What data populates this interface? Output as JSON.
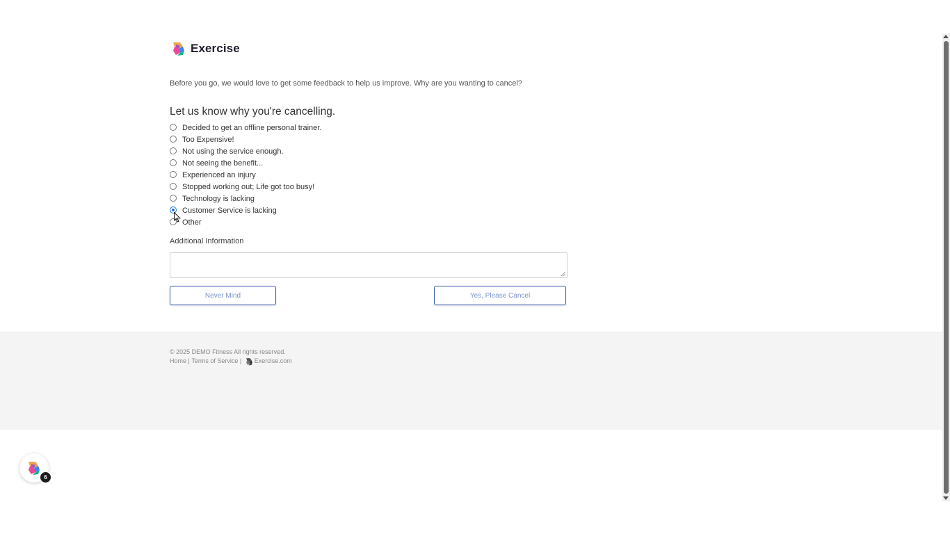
{
  "brand": {
    "name": "Exercise",
    "logo_icon": "exercise-logo-icon"
  },
  "form": {
    "intro": "Before you go, we would love to get some feedback to help us improve. Why are you wanting to cancel?",
    "heading": "Let us know why you're cancelling.",
    "selected_index": 7,
    "reasons": [
      "Decided to get an offline personal trainer.",
      "Too Expensive!",
      "Not using the service enough.",
      "Not seeing the benefit...",
      "Experienced an injury",
      "Stopped working out; Life got too busy!",
      "Technology is lacking",
      "Customer Service is lacking",
      "Other"
    ],
    "additional_label": "Additional Information",
    "additional_value": "",
    "never_mind_label": "Never Mind",
    "cancel_label": "Yes, Please Cancel"
  },
  "footer": {
    "copyright": "© 2025 DEMO Fitness All rights reserved.",
    "home": "Home",
    "separator": " | ",
    "terms": "Terms of Service",
    "site": "Exercise.com"
  },
  "widget": {
    "badge_count": "6"
  },
  "colors": {
    "accent": "#1a73e8",
    "button_border": "#3b5ba8",
    "button_text": "#7b93c9",
    "footer_bg": "#f4f4f4"
  }
}
